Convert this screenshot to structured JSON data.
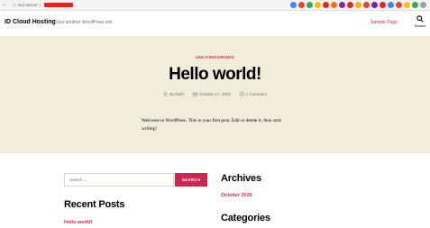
{
  "browser": {
    "nav": {
      "back": "←",
      "forward": "→",
      "reload": "↻"
    },
    "address": {
      "security_label": "Not secure",
      "separator": "|"
    },
    "extension_colors": [
      "#4285f4",
      "#ea4335",
      "#34a853",
      "#fbbc05",
      "#e8231a",
      "#ff6d00",
      "#8e24aa",
      "#e8231a",
      "#f4b400",
      "#ea4335",
      "#7b1fa2",
      "#e8231a",
      "#4285f4",
      "#ea4335",
      "#fbbc05",
      "#34a853",
      "#9e9e9e"
    ]
  },
  "site": {
    "title": "ID Cloud Hosting",
    "description": "Just another WordPress site",
    "menu": [
      {
        "label": "Sample Page"
      }
    ],
    "search_label": "Search"
  },
  "post": {
    "category": "UNCATEGORIZED",
    "title": "Hello world!",
    "author": "By kkdh",
    "date": "October 17, 2020",
    "comments": "1 Comment",
    "content": "Welcome to WordPress. This is your first post. Edit or delete it, then start writing!"
  },
  "widgets": {
    "search": {
      "placeholder": "Search ...",
      "button": "SEARCH"
    },
    "recent_posts": {
      "title": "Recent Posts",
      "items": [
        "Hello world!"
      ]
    },
    "archives": {
      "title": "Archives",
      "items": [
        "October 2020"
      ]
    },
    "categories": {
      "title": "Categories"
    }
  },
  "colors": {
    "accent": "#cd2653",
    "hero_bg": "#f1ecdb",
    "text_muted": "#6d6d6d"
  }
}
